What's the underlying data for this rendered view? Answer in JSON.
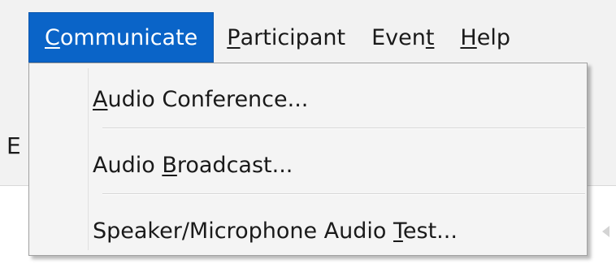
{
  "menubar": {
    "items": [
      {
        "pre": "",
        "acc": "C",
        "post": "ommunicate",
        "active": true
      },
      {
        "pre": "",
        "acc": "P",
        "post": "articipant",
        "active": false
      },
      {
        "pre": "Even",
        "acc": "t",
        "post": "",
        "active": false
      },
      {
        "pre": "",
        "acc": "H",
        "post": "elp",
        "active": false
      }
    ]
  },
  "dropdown": {
    "items": [
      {
        "pre": "",
        "acc": "A",
        "post": "udio Conference..."
      },
      {
        "pre": "Audio ",
        "acc": "B",
        "post": "roadcast..."
      },
      {
        "pre": "Speaker/Microphone Audio ",
        "acc": "T",
        "post": "est..."
      }
    ]
  },
  "background": {
    "partial_letter": "E"
  },
  "colors": {
    "menu_active_bg": "#0a64c8",
    "menu_bg": "#f4f4f4",
    "window_bg": "#f2f2f2"
  }
}
